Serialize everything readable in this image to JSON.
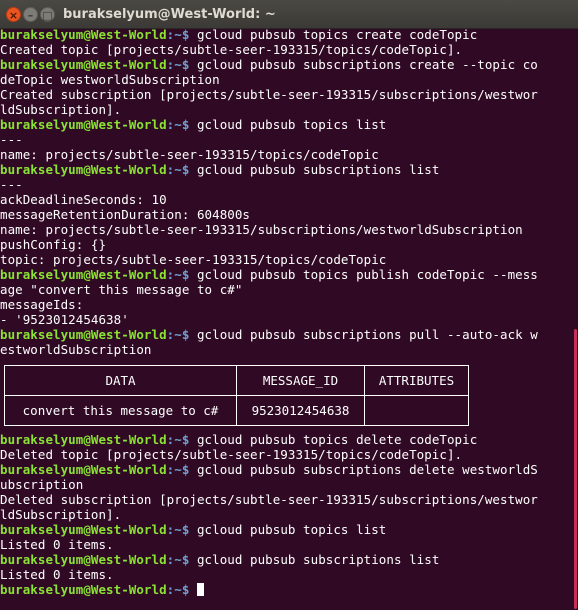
{
  "window": {
    "title": "burakselyum@West-World: ~",
    "close_glyph": "×",
    "minimize_glyph": "–",
    "maximize_glyph": "□"
  },
  "terminal": {
    "prompt_user": "burakselyum@West-World",
    "prompt_path": ":~$",
    "lines": [
      {
        "type": "prompt",
        "text": " gcloud pubsub topics create codeTopic"
      },
      {
        "type": "out",
        "text": "Created topic [projects/subtle-seer-193315/topics/codeTopic]."
      },
      {
        "type": "prompt",
        "text": " gcloud pubsub subscriptions create --topic co"
      },
      {
        "type": "out",
        "text": "deTopic westworldSubscription"
      },
      {
        "type": "out",
        "text": "Created subscription [projects/subtle-seer-193315/subscriptions/westwor"
      },
      {
        "type": "out",
        "text": "ldSubscription]."
      },
      {
        "type": "prompt",
        "text": " gcloud pubsub topics list"
      },
      {
        "type": "out",
        "text": "---"
      },
      {
        "type": "out",
        "text": "name: projects/subtle-seer-193315/topics/codeTopic"
      },
      {
        "type": "prompt",
        "text": " gcloud pubsub subscriptions list"
      },
      {
        "type": "out",
        "text": "---"
      },
      {
        "type": "out",
        "text": "ackDeadlineSeconds: 10"
      },
      {
        "type": "out",
        "text": "messageRetentionDuration: 604800s"
      },
      {
        "type": "out",
        "text": "name: projects/subtle-seer-193315/subscriptions/westworldSubscription"
      },
      {
        "type": "out",
        "text": "pushConfig: {}"
      },
      {
        "type": "out",
        "text": "topic: projects/subtle-seer-193315/topics/codeTopic"
      },
      {
        "type": "prompt",
        "text": " gcloud pubsub topics publish codeTopic --mess"
      },
      {
        "type": "out",
        "text": "age \"convert this message to c#\""
      },
      {
        "type": "out",
        "text": "messageIds:"
      },
      {
        "type": "out",
        "text": "- '9523012454638'"
      },
      {
        "type": "prompt",
        "text": " gcloud pubsub subscriptions pull --auto-ack w"
      },
      {
        "type": "out",
        "text": "estworldSubscription"
      }
    ],
    "table": {
      "headers": [
        "DATA",
        "MESSAGE_ID",
        "ATTRIBUTES"
      ],
      "rows": [
        [
          "convert this message to c#",
          "9523012454638",
          ""
        ]
      ]
    },
    "lines_after": [
      {
        "type": "prompt",
        "text": " gcloud pubsub topics delete codeTopic"
      },
      {
        "type": "out",
        "text": "Deleted topic [projects/subtle-seer-193315/topics/codeTopic]."
      },
      {
        "type": "prompt",
        "text": " gcloud pubsub subscriptions delete westworldS"
      },
      {
        "type": "out",
        "text": "ubscription"
      },
      {
        "type": "out",
        "text": "Deleted subscription [projects/subtle-seer-193315/subscriptions/westwor"
      },
      {
        "type": "out",
        "text": "ldSubscription]."
      },
      {
        "type": "prompt",
        "text": " gcloud pubsub topics list"
      },
      {
        "type": "out",
        "text": "Listed 0 items."
      },
      {
        "type": "prompt",
        "text": " gcloud pubsub subscriptions list"
      },
      {
        "type": "out",
        "text": "Listed 0 items."
      },
      {
        "type": "prompt",
        "text": " "
      }
    ],
    "colors": {
      "background": "#300a24",
      "prompt_user": "#8ae234",
      "prompt_path": "#729fcf",
      "text": "#ffffff",
      "scrollbar": "#c52f58"
    }
  }
}
